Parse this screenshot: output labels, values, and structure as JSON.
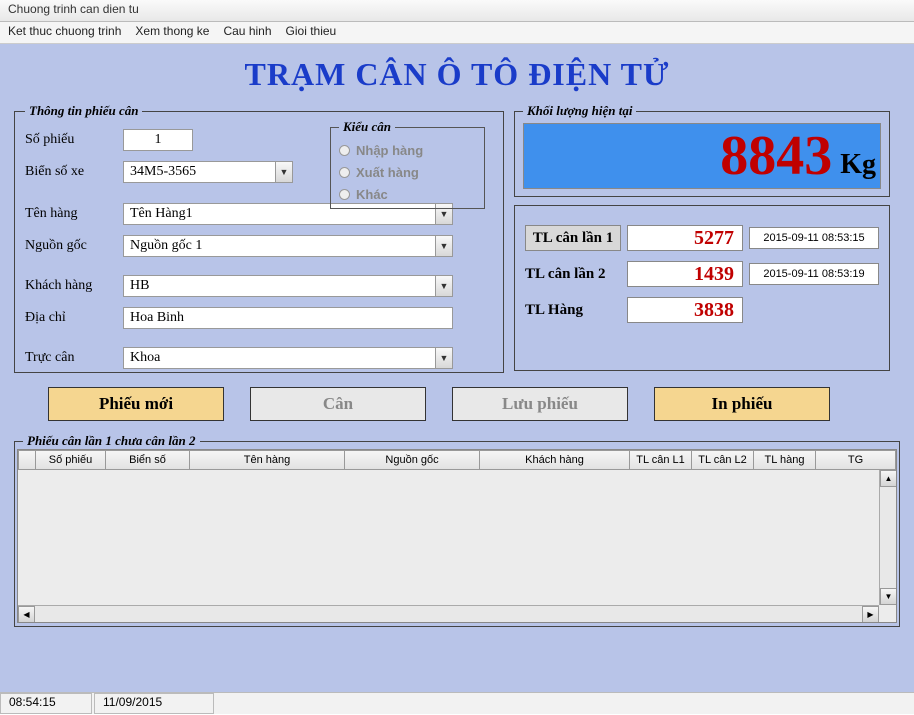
{
  "window": {
    "title": "Chuong trinh can dien tu"
  },
  "menu": {
    "ket_thuc": "Ket thuc chuong trinh",
    "xem": "Xem thong ke",
    "cau_hinh": "Cau hinh",
    "gioi_thieu": "Gioi thieu"
  },
  "page_title": "TRẠM CÂN Ô TÔ ĐIỆN TỬ",
  "info": {
    "legend": "Thông tin phiếu cân",
    "so_phieu_label": "Số phiếu",
    "so_phieu": "1",
    "bien_so_label": "Biển số xe",
    "bien_so": "34M5-3565",
    "ten_hang_label": "Tên hàng",
    "ten_hang": "Tên Hàng1",
    "nguon_goc_label": "Nguồn gốc",
    "nguon_goc": "Nguồn gốc 1",
    "khach_hang_label": "Khách hàng",
    "khach_hang": "HB",
    "dia_chi_label": "Địa chỉ",
    "dia_chi": "Hoa Binh",
    "truc_can_label": "Trực cân",
    "truc_can": "Khoa"
  },
  "kieu": {
    "legend": "Kiểu cân",
    "nhap": "Nhập hàng",
    "xuat": "Xuất hàng",
    "khac": "Khác"
  },
  "weight": {
    "legend": "Khối lượng hiện tại",
    "value": "8843",
    "unit": "Kg"
  },
  "tl": {
    "l1_label": "TL cân lần 1",
    "l1_val": "5277",
    "l1_time": "2015-09-11 08:53:15",
    "l2_label": "TL cân lần 2",
    "l2_val": "1439",
    "l2_time": "2015-09-11 08:53:19",
    "hang_label": "TL Hàng",
    "hang_val": "3838"
  },
  "buttons": {
    "new": "Phiếu mới",
    "can": "Cân",
    "save": "Lưu phiếu",
    "print": "In phiếu"
  },
  "grid": {
    "legend": "Phiếu cân lần 1 chưa cân lần 2",
    "cols": {
      "so_phieu": "Số phiếu",
      "bien_so": "Biển số",
      "ten_hang": "Tên hàng",
      "nguon_goc": "Nguồn gốc",
      "khach_hang": "Khách hàng",
      "tl1": "TL cân L1",
      "tl2": "TL cân L2",
      "tl_hang": "TL hàng",
      "tg": "TG"
    }
  },
  "status": {
    "time": "08:54:15",
    "date": "11/09/2015"
  }
}
